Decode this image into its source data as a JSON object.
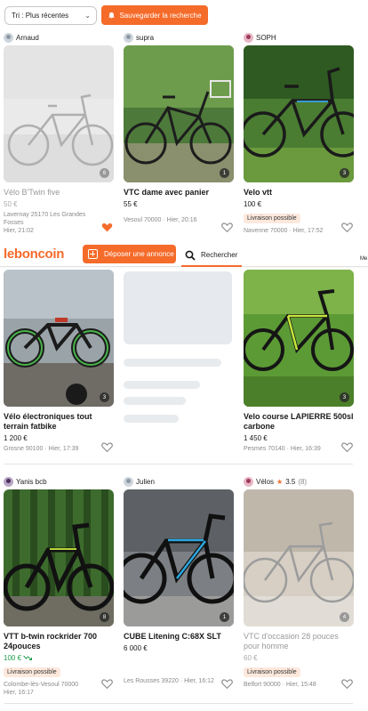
{
  "filter_bar": {
    "sort_label": "Tri : Plus récentes",
    "save_search_label": "Sauvegarder la recherche"
  },
  "header": {
    "logo": "leboncoin",
    "deposit_label": "Déposer une annonce",
    "search_label": "Rechercher",
    "more_label": "Me"
  },
  "listings": [
    {
      "seller": "Arnaud",
      "photo_count": "6",
      "title": "Vélo B'Twin five",
      "price": "50 €",
      "meta": "Lavernay 25170 Les Grandes Fosses",
      "date": "Hier, 21:02",
      "favorited": true,
      "faded": true
    },
    {
      "seller": "supra",
      "photo_count": "1",
      "title": "VTC dame avec panier",
      "price": "55 €",
      "meta": "Vesoul 70000 · Hier, 20:16",
      "favorited": false
    },
    {
      "seller": "SOPH",
      "photo_count": "3",
      "title": "Velo vtt",
      "price": "100 €",
      "delivery": "Livraison possible",
      "meta": "Navenne 70000 · Hier, 17:52",
      "favorited": false
    },
    {
      "photo_count": "3",
      "title": "Vélo électroniques tout terrain fatbike",
      "price": "1 200 €",
      "meta": "Grosne 90100 · Hier, 17:39",
      "favorited": false
    },
    {
      "photo_count": "3",
      "title": "Velo course LAPIERRE 500sl carbone",
      "price": "1 450 €",
      "meta": "Pesmes 70140 · Hier, 16:39",
      "favorited": false
    },
    {
      "seller": "Yanis bcb",
      "photo_count": "8",
      "title": "VTT b-twin rockrider 700 24pouces",
      "price": "100 €",
      "delivery": "Livraison possible",
      "meta": "Colombe-lès-Vesoul 70000",
      "date": "Hier, 16:17",
      "favorited": false
    },
    {
      "seller": "Julien",
      "photo_count": "1",
      "title": "CUBE Litening C:68X SLT",
      "price": "6 000 €",
      "meta": "Les Rousses 39220 · Hier, 16:12",
      "favorited": false
    },
    {
      "seller": "Vélos",
      "rating": "3.5",
      "rating_count": "(8)",
      "photo_count": "4",
      "title": "VTC d'occasion 28 pouces pour homme",
      "price": "60 €",
      "delivery": "Livraison possible",
      "meta": "Belfort 90000 · Hier, 15:48",
      "favorited": false,
      "faded": true
    }
  ],
  "colors": {
    "accent": "#f56b2a",
    "price_drop": "#1f9d4b"
  }
}
